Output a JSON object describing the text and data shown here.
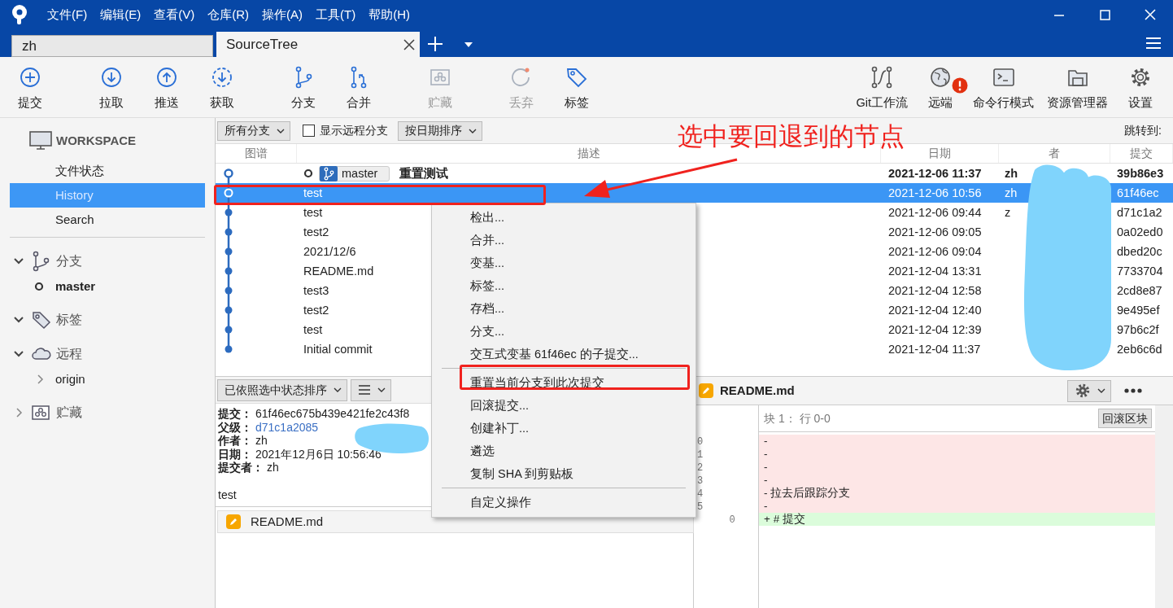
{
  "window": {
    "menu": [
      "文件(F)",
      "编辑(E)",
      "查看(V)",
      "仓库(R)",
      "操作(A)",
      "工具(T)",
      "帮助(H)"
    ]
  },
  "tabs": [
    {
      "label": "zh",
      "selected": false
    },
    {
      "label": "SourceTree",
      "selected": true
    }
  ],
  "toolbar": {
    "items": [
      {
        "label": "提交",
        "disabled": false,
        "alert": false
      },
      {
        "label": "拉取",
        "disabled": false,
        "alert": false
      },
      {
        "label": "推送",
        "disabled": false,
        "alert": false
      },
      {
        "label": "获取",
        "disabled": false,
        "alert": false
      },
      {
        "label": "分支",
        "disabled": false,
        "alert": false
      },
      {
        "label": "合并",
        "disabled": false,
        "alert": false
      },
      {
        "label": "贮藏",
        "disabled": true,
        "alert": false
      },
      {
        "label": "丢弃",
        "disabled": true,
        "alert": false
      },
      {
        "label": "标签",
        "disabled": false,
        "alert": false
      },
      {
        "label": "Git工作流",
        "disabled": false,
        "alert": false
      },
      {
        "label": "远端",
        "disabled": false,
        "alert": true
      },
      {
        "label": "命令行模式",
        "disabled": false,
        "alert": false
      },
      {
        "label": "资源管理器",
        "disabled": false,
        "alert": false
      },
      {
        "label": "设置",
        "disabled": false,
        "alert": false
      }
    ]
  },
  "sidebar": {
    "workspace": "WORKSPACE",
    "items": [
      {
        "label": "文件状态",
        "selected": false
      },
      {
        "label": "History",
        "selected": true
      },
      {
        "label": "Search",
        "selected": false
      }
    ],
    "sections": [
      {
        "label": "分支",
        "expanded": true,
        "children": [
          {
            "label": "master",
            "current": true
          }
        ]
      },
      {
        "label": "标签",
        "expanded": true
      },
      {
        "label": "远程",
        "expanded": true,
        "children": [
          {
            "label": "origin",
            "expanded": false
          }
        ]
      },
      {
        "label": "贮藏",
        "expanded": false
      }
    ]
  },
  "filter_bar": {
    "branches": "所有分支",
    "show_remote": {
      "label": "显示远程分支",
      "checked": false
    },
    "sort": "按日期排序",
    "jump_label": "跳转到:"
  },
  "table": {
    "columns": [
      "图谱",
      "描述",
      "日期",
      "者",
      "提交"
    ],
    "rows": [
      {
        "description": "重置测试",
        "branch": "master",
        "date": "2021-12-06 11:37",
        "author": "zh",
        "commit": "39b86e3",
        "head": true,
        "selected": false
      },
      {
        "description": "test",
        "date": "2021-12-06 10:56",
        "author": "zh",
        "commit": "61f46ec",
        "head": false,
        "selected": true
      },
      {
        "description": "test",
        "date": "2021-12-06 09:44",
        "author": "z",
        "commit": "d71c1a2",
        "head": false,
        "selected": false
      },
      {
        "description": "test2",
        "date": "2021-12-06 09:05",
        "commit": "0a02ed0",
        "head": false,
        "selected": false
      },
      {
        "description": "2021/12/6",
        "date": "2021-12-06 09:04",
        "commit": "dbed20c",
        "head": false,
        "selected": false
      },
      {
        "description": "README.md",
        "date": "2021-12-04 13:31",
        "commit": "7733704",
        "head": false,
        "selected": false
      },
      {
        "description": "test3",
        "date": "2021-12-04 12:58",
        "commit": "2cd8e87",
        "head": false,
        "selected": false
      },
      {
        "description": "test2",
        "date": "2021-12-04 12:40",
        "commit": "9e495ef",
        "head": false,
        "selected": false
      },
      {
        "description": "test",
        "date": "2021-12-04 12:39",
        "commit": "97b6c2f",
        "head": false,
        "selected": false
      },
      {
        "description": "Initial commit",
        "date": "2021-12-04 11:37",
        "commit": "2eb6c6d",
        "head": false,
        "selected": false
      }
    ]
  },
  "details": {
    "sort": "已依照选中状态排序",
    "fields": [
      {
        "label": "提交：",
        "value": "61f46ec675b439e421fe2c43f8",
        "kind": "text"
      },
      {
        "label": "父级：",
        "value": "d71c1a2085",
        "kind": "link"
      },
      {
        "label": "作者：",
        "value": "zh",
        "kind": "text"
      },
      {
        "label": "日期：",
        "value": "2021年12月6日 10:56:46",
        "kind": "text"
      },
      {
        "label": "提交者：",
        "value": "zh",
        "kind": "text"
      }
    ],
    "message": "test",
    "files": [
      {
        "name": "README.md"
      }
    ]
  },
  "diff": {
    "file": "README.md",
    "hunk": "块 1： 行 0-0",
    "hunk_button": "回滚区块",
    "lines": [
      {
        "kind": "del",
        "old": "0",
        "text": "-"
      },
      {
        "kind": "del",
        "old": "1",
        "text": "-"
      },
      {
        "kind": "del",
        "old": "2",
        "text": "-"
      },
      {
        "kind": "del",
        "old": "3",
        "text": "-"
      },
      {
        "kind": "del",
        "old": "4",
        "text": "- 拉去后跟踪分支"
      },
      {
        "kind": "del",
        "old": "5",
        "text": "-"
      },
      {
        "kind": "add",
        "new": "0",
        "text": "+ # 提交"
      }
    ]
  },
  "context_menu": {
    "items": [
      {
        "kind": "item",
        "label": "检出..."
      },
      {
        "kind": "item",
        "label": "合并..."
      },
      {
        "kind": "item",
        "label": "变基..."
      },
      {
        "kind": "item",
        "label": "标签..."
      },
      {
        "kind": "item",
        "label": "存档..."
      },
      {
        "kind": "item",
        "label": "分支..."
      },
      {
        "kind": "item",
        "label": "交互式变基 61f46ec 的子提交..."
      },
      {
        "kind": "separator"
      },
      {
        "kind": "item",
        "label": "重置当前分支到此次提交"
      },
      {
        "kind": "item",
        "label": "回滚提交..."
      },
      {
        "kind": "item",
        "label": "创建补丁..."
      },
      {
        "kind": "item",
        "label": "遴选"
      },
      {
        "kind": "item",
        "label": "复制 SHA 到剪贴板"
      },
      {
        "kind": "separator"
      },
      {
        "kind": "item",
        "label": "自定义操作"
      }
    ]
  },
  "annotation": {
    "text": "选中要回退到的节点"
  }
}
